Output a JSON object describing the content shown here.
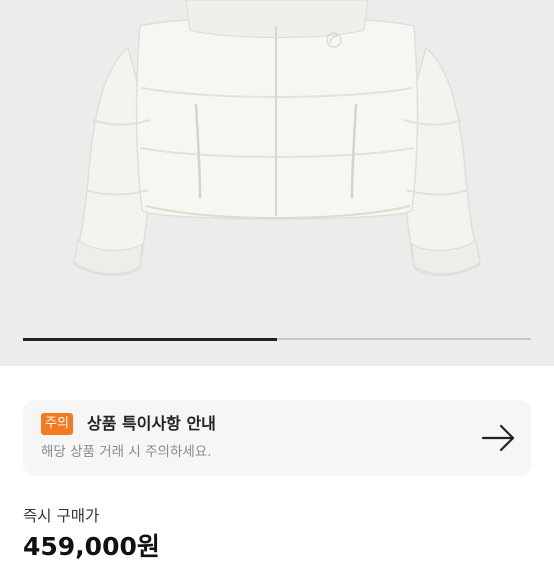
{
  "product": {
    "image_alt": "white sherpa fleece puffer jacket",
    "logo_icon": "brand-logo-icon"
  },
  "carousel": {
    "progress": 0.5
  },
  "notice": {
    "badge": "주의",
    "title": "상품 특이사항 안내",
    "subtitle": "해당 상품 거래 시 주의하세요.",
    "arrow_icon": "arrow-right-icon"
  },
  "price": {
    "label": "즉시 구매가",
    "value": "459,000원"
  },
  "colors": {
    "accent": "#f47a20",
    "hero_bg": "#ececec",
    "card_bg": "#f6f6f6"
  }
}
